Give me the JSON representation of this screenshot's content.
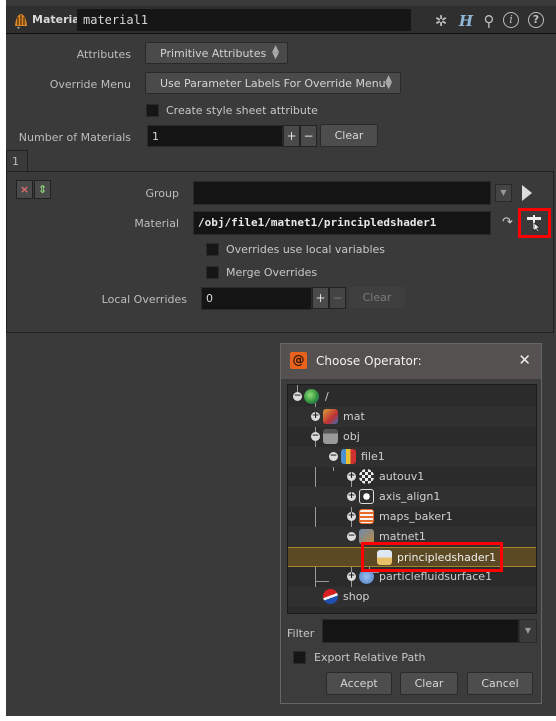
{
  "header": {
    "node_type": "Material",
    "node_name": "material1",
    "icons": [
      "gear-icon",
      "houdini-help-h-icon",
      "search-icon",
      "info-icon",
      "help-icon"
    ]
  },
  "params": {
    "attributes_label": "Attributes",
    "attributes_value": "Primitive Attributes",
    "override_menu_label": "Override Menu",
    "override_menu_value": "Use Parameter Labels For Override Menu",
    "create_style_sheet_label": "Create style sheet attribute",
    "create_style_sheet_checked": false,
    "num_materials_label": "Number of Materials",
    "num_materials_value": "1",
    "plus": "+",
    "minus": "−",
    "clear": "Clear"
  },
  "multiparm": {
    "tab_label": "1",
    "remove_icon": "×",
    "insert_icon": "⇕",
    "group_label": "Group",
    "group_value": "",
    "material_label": "Material",
    "material_value": "/obj/file1/matnet1/principledshader1",
    "overrides_local_label": "Overrides use local variables",
    "merge_overrides_label": "Merge Overrides",
    "local_overrides_label": "Local Overrides",
    "local_overrides_value": "0",
    "plus": "+",
    "minus": "−",
    "clear": "Clear"
  },
  "dialog": {
    "title": "Choose Operator:",
    "close": "✕",
    "tree": [
      {
        "label": "/",
        "depth": 0,
        "expander": "minus"
      },
      {
        "label": "mat",
        "depth": 1,
        "expander": "plus"
      },
      {
        "label": "obj",
        "depth": 1,
        "expander": "minus"
      },
      {
        "label": "file1",
        "depth": 2,
        "expander": "minus"
      },
      {
        "label": "autouv1",
        "depth": 3,
        "expander": "plus"
      },
      {
        "label": "axis_align1",
        "depth": 3,
        "expander": "plus"
      },
      {
        "label": "maps_baker1",
        "depth": 3,
        "expander": "plus"
      },
      {
        "label": "matnet1",
        "depth": 3,
        "expander": "minus"
      },
      {
        "label": "principledshader1",
        "depth": 4,
        "expander": "none",
        "selected": true
      },
      {
        "label": "particlefluidsurface1",
        "depth": 3,
        "expander": "plus"
      },
      {
        "label": "shop",
        "depth": 1,
        "expander": "none"
      }
    ],
    "filter_label": "Filter",
    "filter_value": "",
    "export_relative_label": "Export Relative Path",
    "accept": "Accept",
    "clear": "Clear",
    "cancel": "Cancel"
  }
}
